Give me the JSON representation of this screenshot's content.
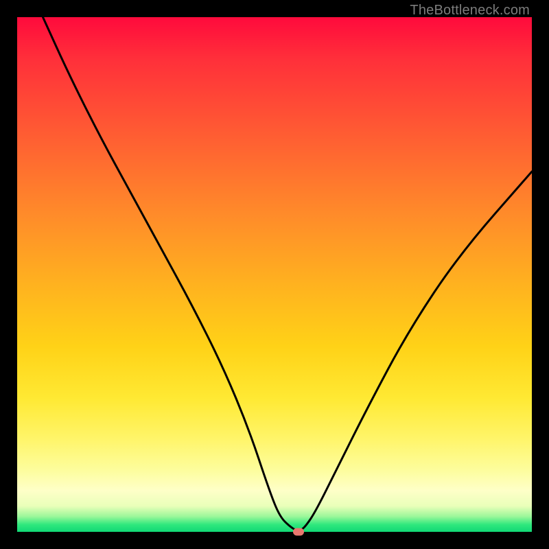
{
  "attribution": "TheBottleneck.com",
  "chart_data": {
    "type": "line",
    "title": "",
    "xlabel": "",
    "ylabel": "",
    "xlim": [
      0,
      100
    ],
    "ylim": [
      0,
      100
    ],
    "grid": false,
    "legend": false,
    "series": [
      {
        "name": "bottleneck-curve",
        "x": [
          5,
          10,
          16,
          22,
          28,
          34,
          40,
          45,
          49,
          51,
          53,
          54.7,
          56,
          58,
          62,
          68,
          76,
          86,
          100
        ],
        "values": [
          100,
          89,
          77,
          66,
          55,
          44,
          32,
          20,
          8,
          3,
          1,
          0,
          1,
          4,
          12,
          24,
          39,
          54,
          70
        ]
      }
    ],
    "marker": {
      "x": 54.7,
      "y": 0
    },
    "gradient_stops": [
      {
        "pos": 0,
        "color": "#ff0a3c"
      },
      {
        "pos": 8,
        "color": "#ff2f3a"
      },
      {
        "pos": 22,
        "color": "#ff5a33"
      },
      {
        "pos": 38,
        "color": "#ff8a2a"
      },
      {
        "pos": 52,
        "color": "#ffb21f"
      },
      {
        "pos": 64,
        "color": "#ffd217"
      },
      {
        "pos": 74,
        "color": "#ffe933"
      },
      {
        "pos": 82,
        "color": "#fff56a"
      },
      {
        "pos": 88,
        "color": "#fdfd9d"
      },
      {
        "pos": 92,
        "color": "#feffc8"
      },
      {
        "pos": 95,
        "color": "#e9ffb9"
      },
      {
        "pos": 97,
        "color": "#9cf79a"
      },
      {
        "pos": 98.6,
        "color": "#2fe87d"
      },
      {
        "pos": 100,
        "color": "#11d876"
      }
    ]
  }
}
